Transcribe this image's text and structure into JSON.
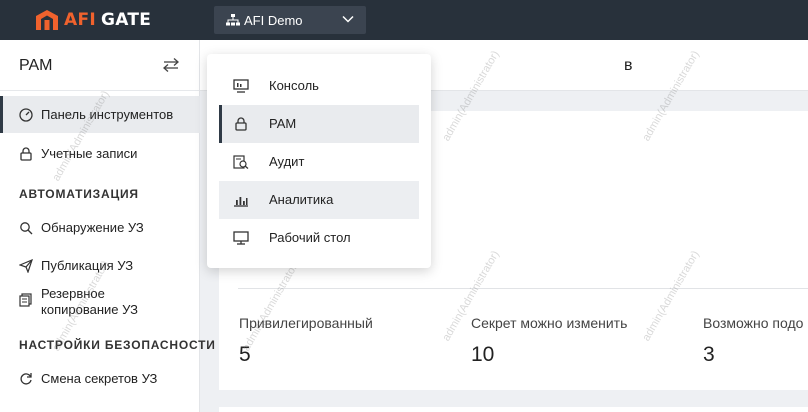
{
  "brand": {
    "afi": "AFI",
    "gate": "GATE",
    "accent": "#f0622d"
  },
  "tenant": {
    "label": "AFI Demo"
  },
  "sidebar": {
    "title": "PAM",
    "items": [
      {
        "label": "Панель инструментов",
        "icon": "dashboard-icon",
        "active": true
      },
      {
        "label": "Учетные записи",
        "icon": "lock-icon"
      }
    ],
    "sections": [
      {
        "title": "АВТОМАТИЗАЦИЯ",
        "items": [
          {
            "label": "Обнаружение УЗ",
            "icon": "search-icon"
          },
          {
            "label": "Публикация УЗ",
            "icon": "send-icon"
          },
          {
            "label_line1": "Резервное",
            "label_line2": "копирование УЗ",
            "icon": "backup-icon"
          }
        ]
      },
      {
        "title": "НАСТРОЙКИ БЕЗОПАСНОСТИ",
        "items": [
          {
            "label": "Смена секретов УЗ",
            "icon": "rotate-icon"
          }
        ]
      }
    ]
  },
  "header": {
    "title_fragment": "в"
  },
  "app_menu": {
    "items": [
      {
        "label": "Консоль",
        "icon": "console-icon"
      },
      {
        "label": "PAM",
        "icon": "lock-icon",
        "selected": true
      },
      {
        "label": "Аудит",
        "icon": "audit-icon"
      },
      {
        "label": "Аналитика",
        "icon": "analytics-icon",
        "hover": true
      },
      {
        "label": "Рабочий стол",
        "icon": "desktop-icon"
      }
    ]
  },
  "stats": [
    {
      "label": "Привилегированный",
      "value": "5"
    },
    {
      "label": "Секрет можно изменить",
      "value": "10"
    },
    {
      "label": "Возможно подо",
      "value": "3"
    }
  ],
  "watermark": "admin(Administrator)"
}
